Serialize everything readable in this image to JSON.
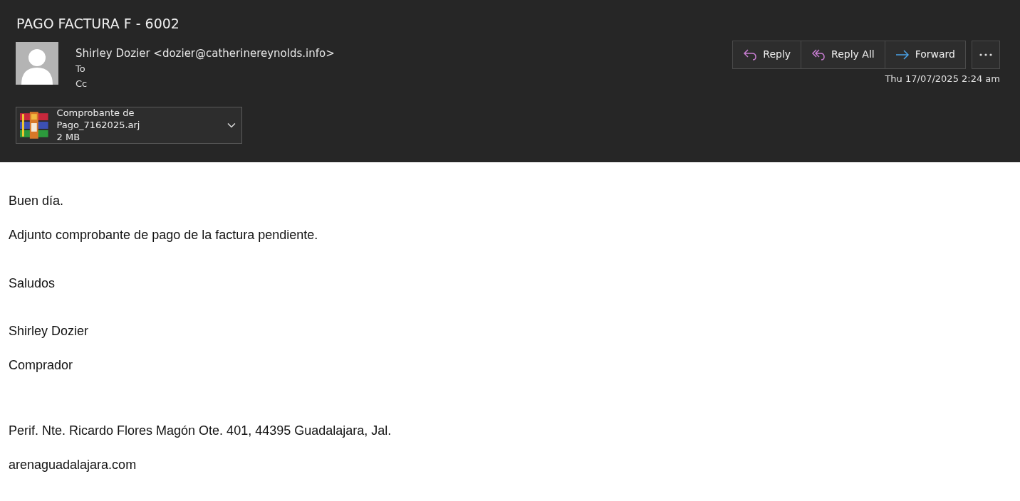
{
  "message": {
    "subject": "PAGO FACTURA F - 6002",
    "sender": "Shirley Dozier <dozier@catherinereynolds.info>",
    "to_label": "To",
    "cc_label": "Cc",
    "date": "Thu 17/07/2025 2:24 am"
  },
  "actions": [
    {
      "kind": "reply",
      "label": "Reply"
    },
    {
      "kind": "reply-all",
      "label": "Reply All"
    },
    {
      "kind": "forward",
      "label": "Forward"
    }
  ],
  "attachment": {
    "name": "Comprobante de Pago_7162025.arj",
    "size": "2 MB"
  },
  "body": [
    "Buen día.",
    "Adjunto comprobante de pago de la factura pendiente.",
    "Saludos",
    "Shirley Dozier",
    "Comprador",
    "Perif. Nte. Ricardo Flores Magón Ote. 401, 44395 Guadalajara, Jal.",
    "arenaguadalajara.com"
  ]
}
